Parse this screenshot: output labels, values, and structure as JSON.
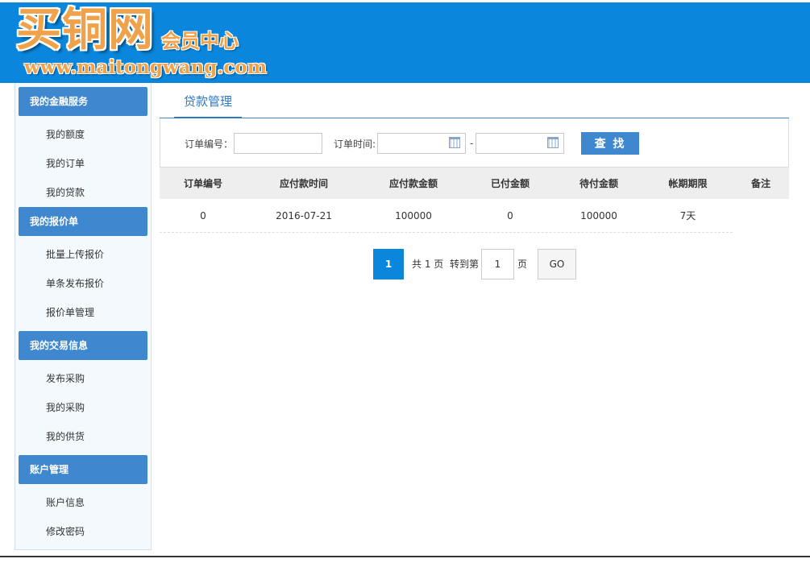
{
  "header": {
    "logo_main": "买铜网",
    "logo_sub": "会员中心",
    "logo_url": "www.maitongwang.com"
  },
  "sidebar": {
    "groups": [
      {
        "title": "我的金融服务",
        "items": [
          "我的额度",
          "我的订单",
          "我的贷款"
        ]
      },
      {
        "title": "我的报价单",
        "items": [
          "批量上传报价",
          "单条发布报价",
          "报价单管理"
        ]
      },
      {
        "title": "我的交易信息",
        "items": [
          "发布采购",
          "我的采购",
          "我的供货"
        ]
      },
      {
        "title": "账户管理",
        "items": [
          "账户信息",
          "修改密码"
        ]
      }
    ]
  },
  "main": {
    "tab": "贷款管理",
    "search": {
      "order_no_label": "订单编号：",
      "order_no_value": "",
      "order_time_label": "订单时间:",
      "date_from": "",
      "date_sep": "-",
      "date_to": "",
      "search_button": "查 找"
    },
    "table": {
      "columns": [
        "订单编号",
        "应付款时间",
        "应付款金额",
        "已付金额",
        "待付金额",
        "帐期期限",
        "备注"
      ],
      "rows": [
        [
          "0",
          "2016-07-21",
          "100000",
          "0",
          "100000",
          "7天",
          ""
        ]
      ]
    },
    "pager": {
      "current": "1",
      "total_text": "共 1 页",
      "goto_label": "转到第",
      "goto_value": "1",
      "page_unit": "页",
      "go_button": "GO"
    }
  },
  "colors": {
    "header_bg": "#0a86dc",
    "sidebar_title_bg": "#3f87cf",
    "accent": "#2a7ac6",
    "logo_orange": "#f0a24a"
  }
}
